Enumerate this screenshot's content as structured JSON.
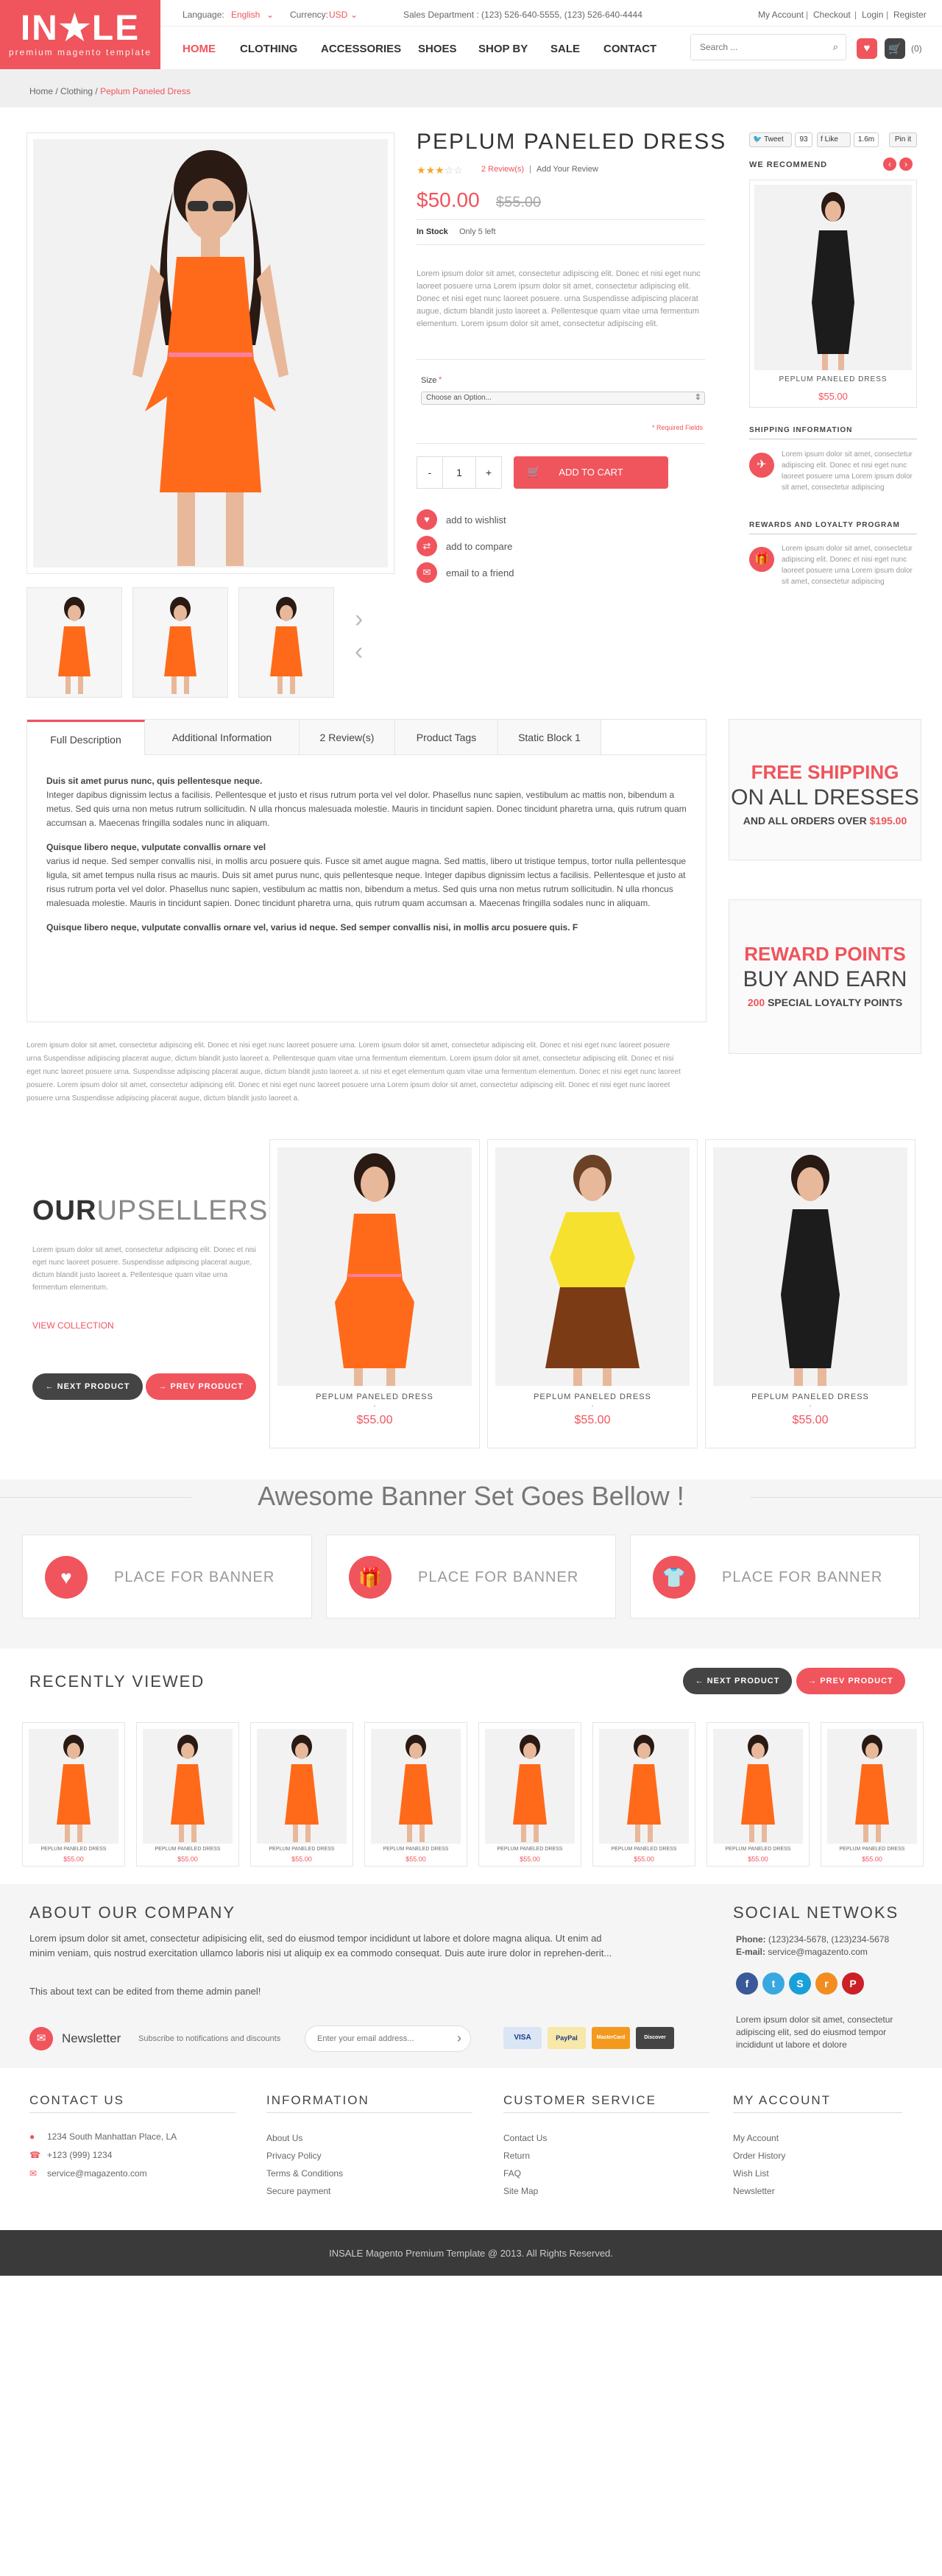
{
  "header": {
    "logo_text": "IN★LE",
    "logo_sub": "premium magento template",
    "language_label": "Language:",
    "language_value": "English",
    "currency_label": "Currency:",
    "currency_value": "USD",
    "sales_dept": "Sales Department : (123) 526-640-5555, (123) 526-640-4444",
    "my_account": "My Account",
    "checkout": "Checkout",
    "login": "Login",
    "register": "Register",
    "sep": "|",
    "nav": [
      "HOME",
      "CLOTHING",
      "ACCESSORIES",
      "SHOES",
      "SHOP BY",
      "SALE",
      "CONTACT"
    ],
    "search_placeholder": "Search ...",
    "cart_count": "(0)"
  },
  "breadcrumb": {
    "home": "Home",
    "clothing": "Clothing",
    "current": "Peplum Paneled Dress",
    "sep": "/"
  },
  "product": {
    "title": "PEPLUM PANELED DRESS",
    "rating": 3,
    "reviews": "2 Review(s)",
    "add_review": "Add Your Review",
    "price": "$50.00",
    "old_price": "$55.00",
    "stock": "In Stock",
    "only_left": "Only 5 left",
    "description": "Lorem ipsum dolor sit amet, consectetur adipiscing elit. Donec et nisi eget nunc laoreet posuere urna Lorem ipsum dolor sit amet, consectetur adipiscing elit. Donec et nisi eget nunc laoreet posuere. urna Suspendisse adipiscing placerat augue, dictum blandit justo laoreet a. Pellentesque quam vitae urna fermentum elementum. Lorem ipsum dolor sit amet, consectetur adipiscing elit.",
    "size_label": "Size",
    "required_star": "*",
    "size_option": "Choose an Option...",
    "required_fields": "* Required Fields",
    "qty_minus": "-",
    "qty_value": "1",
    "qty_plus": "+",
    "add_to_cart": "ADD TO CART",
    "wishlist": "add to wishlist",
    "compare": "add to compare",
    "email": "email to a friend"
  },
  "social_counts": {
    "tweet": "Tweet",
    "tweet_n": "93",
    "like": "Like",
    "like_n": "1.6m",
    "pin": "Pin it"
  },
  "sidebar": {
    "we_recommend": "WE RECOMMEND",
    "rec_name": "PEPLUM PANELED DRESS",
    "rec_price": "$55.00",
    "shipping_head": "SHIPPING INFORMATION",
    "shipping_text": "Lorem ipsum dolor sit amet, consectetur adipiscing elit. Donec et nisi eget nunc laoreet posuere urna Lorem ipsum dolor sit amet, consectetur adipiscing",
    "rewards_head": "REWARDS AND LOYALTY PROGRAM",
    "rewards_text": "Lorem ipsum dolor sit amet, consectetur adipiscing elit. Donec et nisi eget nunc laoreet posuere urna Lorem ipsum dolor sit amet, consectetur adipiscing"
  },
  "tabs": [
    "Full Description",
    "Additional Information",
    "2 Review(s)",
    "Product Tags",
    "Static Block 1"
  ],
  "full_description": {
    "p1_title": "Duis sit amet purus nunc, quis pellentesque neque.",
    "p1": "Integer dapibus dignissim lectus a facilisis. Pellentesque et justo et risus rutrum porta vel vel dolor. Phasellus nunc sapien, vestibulum ac mattis non, bibendum a metus. Sed quis urna non metus rutrum sollicitudin. N ulla rhoncus malesuada molestie. Mauris in tincidunt sapien. Donec tincidunt pharetra urna, quis rutrum quam accumsan a. Maecenas fringilla sodales nunc in aliquam.",
    "p2_title": "Quisque libero neque, vulputate convallis ornare vel",
    "p2": " varius id neque. Sed semper convallis nisi, in mollis arcu posuere quis. Fusce sit amet augue magna. Sed mattis, libero ut tristique tempus, tortor nulla pellentesque ligula, sit amet tempus nulla risus ac mauris. Duis sit amet purus nunc, quis pellentesque neque. Integer dapibus dignissim lectus a facilisis. Pellentesque et justo at risus rutrum porta vel vel dolor. Phasellus nunc sapien, vestibulum ac mattis non, bibendum a metus. Sed quis urna non metus rutrum sollicitudin. N ulla rhoncus malesuada molestie. Mauris in tincidunt sapien. Donec tincidunt pharetra urna, quis rutrum quam accumsan a. Maecenas fringilla sodales nunc in aliquam.",
    "p3_title": "Quisque libero neque, vulputate convallis ornare vel, varius id neque. Sed semper convallis nisi, in mollis arcu posuere quis. F"
  },
  "promo_shipping": {
    "l1": "FREE SHIPPING",
    "l2": "ON ALL DRESSES",
    "l3": "AND ALL ORDERS OVER",
    "l3_amount": "$195.00"
  },
  "promo_reward": {
    "l1": "REWARD POINTS",
    "l2": "BUY AND EARN",
    "l3_num": "200",
    "l3": "SPECIAL LOYALTY POINTS"
  },
  "lower_lorem": "Lorem ipsum dolor sit amet, consectetur adipiscing elit. Donec et nisi eget nunc laoreet posuere urna. Lorem ipsum dolor sit amet, consectetur adipiscing elit. Donec et nisi eget nunc laoreet posuere urna Suspendisse adipiscing placerat augue, dictum blandit justo laoreet a. Pellentesque quam vitae urna fermentum elementum. Lorem ipsum dolor sit amet, consectetur adipiscing elit. Donec et nisi eget nunc laoreet posuere urna. Suspendisse adipiscing placerat augue, dictum blandit justo laoreet a. ut nisi et eget elementum quam vitae urna fermentum elementum. Donec et nisi eget nunc laoreet posuere. Lorem ipsum dolor sit amet, consectetur adipiscing elit. Donec et nisi eget nunc laoreet posuere urna Lorem ipsum dolor sit amet, consectetur adipiscing elit. Donec et nisi eget nunc laoreet posuere urna Suspendisse adipiscing placerat augue, dictum blandit justo laoreet a.",
  "upsellers": {
    "title_bold": "OUR",
    "title_light": "UPSELLERS",
    "text": "Lorem ipsum dolor sit amet, consectetur adipiscing elit. Donec et nisi eget nunc laoreet posuere. Suspendisse adipiscing placerat augue, dictum blandit justo laoreet a. Pellentesque quam vitae urna fermentum elementum.",
    "view_collection": "VIEW COLLECTION",
    "next": "NEXT PRODUCT",
    "prev": "PREV PRODUCT",
    "products": [
      {
        "name": "PEPLUM PANELED DRESS",
        "price": "$55.00"
      },
      {
        "name": "PEPLUM PANELED DRESS",
        "price": "$55.00"
      },
      {
        "name": "PEPLUM PANELED DRESS",
        "price": "$55.00"
      }
    ]
  },
  "banner_section": {
    "title": "Awesome Banner Set Goes Bellow !",
    "banners": [
      "PLACE FOR BANNER",
      "PLACE FOR BANNER",
      "PLACE FOR BANNER"
    ]
  },
  "recently_viewed": {
    "title": "RECENTLY VIEWED",
    "next": "NEXT PRODUCT",
    "prev": "PREV PRODUCT",
    "item_name": "PEPLUM PANELED DRESS",
    "item_price": "$55.00"
  },
  "about": {
    "title": "ABOUT OUR COMPANY",
    "text": "Lorem ipsum dolor sit amet, consectetur adipisicing elit, sed do eiusmod tempor incididunt ut labore et dolore magna aliqua. Ut enim ad minim veniam, quis nostrud exercitation ullamco laboris nisi ut aliquip ex ea commodo consequat. Duis aute irure dolor in reprehen-derit...",
    "edit_note": "This about text can be edited from theme admin panel!"
  },
  "newsletter": {
    "label": "Newsletter",
    "desc": "Subscribe to notifications and discounts",
    "placeholder": "Enter your email address..."
  },
  "payments": [
    "VISA",
    "PayPal",
    "MasterCard",
    "Discover"
  ],
  "social": {
    "title": "SOCIAL NETWOKS",
    "phone_label": "Phone:",
    "phone": "(123)234-5678, (123)234-5678",
    "email_label": "E-mail:",
    "email": "service@magazento.com",
    "icons": [
      "f",
      "t",
      "S",
      "r",
      "P"
    ],
    "text": "Lorem ipsum dolor sit amet, consectetur adipiscing elit, sed do eiusmod tempor incididunt ut labore et dolore"
  },
  "contact": {
    "title": "CONTACT US",
    "address": "1234 South Manhattan Place, LA",
    "phone": "+123 (999) 1234",
    "email": "service@magazento.com"
  },
  "information": {
    "title": "INFORMATION",
    "links": [
      "About Us",
      "Privacy Policy",
      "Terms & Conditions",
      "Secure payment"
    ]
  },
  "customer_service": {
    "title": "CUSTOMER SERVICE",
    "links": [
      "Contact Us",
      "Return",
      "FAQ",
      "Site Map"
    ]
  },
  "my_account": {
    "title": "MY ACCOUNT",
    "links": [
      "My Account",
      "Order History",
      "Wish List",
      "Newsletter"
    ]
  },
  "footer": {
    "copyright": "INSALE Magento Premium Template @ 2013. All Rights Reserved."
  },
  "colors": {
    "accent": "#f0545c",
    "dark": "#3a3a3a"
  }
}
